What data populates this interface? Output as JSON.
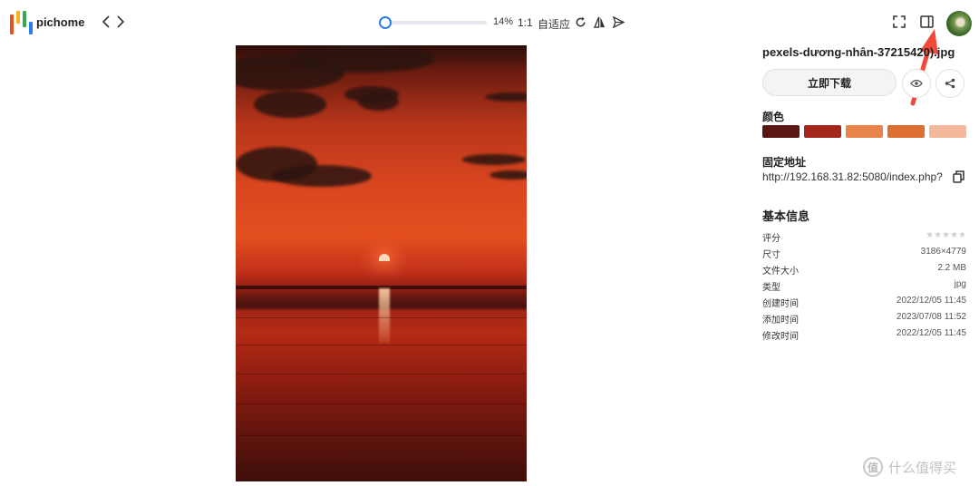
{
  "app": {
    "brand": "pichome",
    "logo_colors": [
      "#e6531d",
      "#f4b41a",
      "#3aa757",
      "#2b7de9"
    ]
  },
  "toolbar": {
    "zoom_percent": 14,
    "zoom_label": "14%",
    "actual_size_label": "1:1",
    "fit_label": "自适应",
    "icons": [
      "chevron-left-icon",
      "chevron-right-icon",
      "rotate-icon",
      "flip-icon",
      "send-icon",
      "fullscreen-icon",
      "sidebar-toggle-icon"
    ]
  },
  "file": {
    "name": "pexels-dương-nhân-37215420).jpg",
    "download_label": "立即下载"
  },
  "colors": {
    "title": "颜色",
    "swatches": [
      "#5a1612",
      "#a3261d",
      "#e8834a",
      "#de6f33",
      "#f4b99b"
    ]
  },
  "url": {
    "title": "固定地址",
    "value": "http://192.168.31.82:5080/index.php?..."
  },
  "info": {
    "title": "基本信息",
    "rating_label": "评分",
    "rating_value": 0,
    "rating_max": 5,
    "rows": [
      {
        "label": "尺寸",
        "value": "3186×4779"
      },
      {
        "label": "文件大小",
        "value": "2.2 MB"
      },
      {
        "label": "类型",
        "value": "jpg"
      },
      {
        "label": "创建时间",
        "value": "2022/12/05 11:45"
      },
      {
        "label": "添加时间",
        "value": "2023/07/08 11:52"
      },
      {
        "label": "修改时间",
        "value": "2022/12/05 11:45"
      }
    ]
  },
  "watermark": {
    "badge": "值",
    "text": "什么值得买"
  },
  "annotation": {
    "arrow_color": "#f04a3a"
  }
}
